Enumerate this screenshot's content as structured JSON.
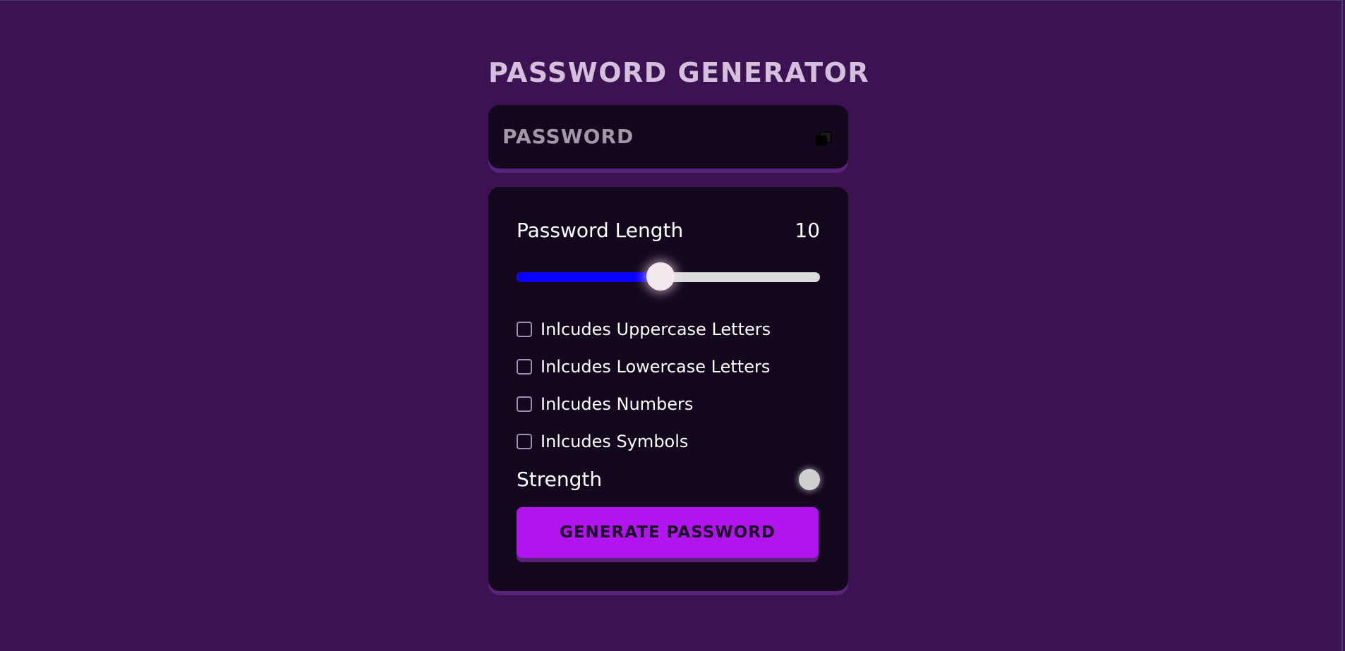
{
  "app": {
    "title": "PASSWORD GENERATOR"
  },
  "display": {
    "placeholder": "PASSWORD",
    "copy_icon": "copy-icon"
  },
  "length": {
    "label": "Password Length",
    "value": "10",
    "slider_fraction": 0.475
  },
  "options": [
    {
      "label": "Inlcudes Uppercase Letters",
      "checked": false
    },
    {
      "label": "Inlcudes Lowercase Letters",
      "checked": false
    },
    {
      "label": "Inlcudes Numbers",
      "checked": false
    },
    {
      "label": "Inlcudes Symbols",
      "checked": false
    }
  ],
  "strength": {
    "label": "Strength",
    "indicator_color": "#cfcfcf"
  },
  "generate": {
    "label": "GENERATE PASSWORD"
  },
  "colors": {
    "background": "#3b1352",
    "card": "#14081f",
    "accent": "#b115ee",
    "slider_fill": "#0a00ff",
    "title": "#d6bfdc"
  }
}
